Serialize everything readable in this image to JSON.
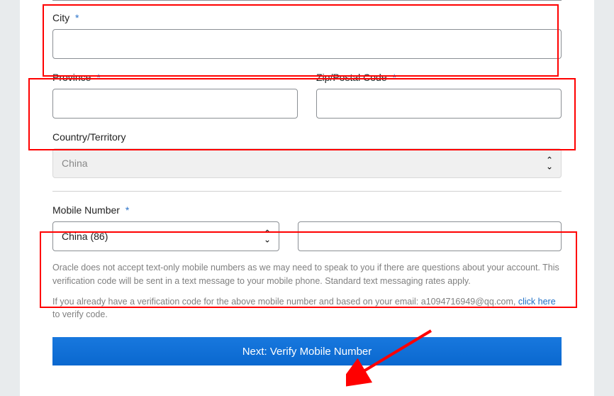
{
  "fields": {
    "city": {
      "label": "City",
      "value": ""
    },
    "province": {
      "label": "Province",
      "value": ""
    },
    "zip": {
      "label": "Zip/Postal Code",
      "value": ""
    },
    "country": {
      "label": "Country/Territory",
      "selected": "China"
    },
    "mobile": {
      "label": "Mobile Number",
      "country_code": "China (86)",
      "value": ""
    }
  },
  "help": {
    "line1": "Oracle does not accept text-only mobile numbers as we may need to speak to you if there are questions about your account. This verification code will be sent in a text message to your mobile phone. Standard text messaging rates apply.",
    "line2_a": "If you already have a verification code for the above mobile number and based on your email: ",
    "email": "a1094716949@qq.com",
    "line2_b": ", ",
    "link": "click here",
    "line2_c": " to verify code."
  },
  "button": {
    "next": "Next: Verify Mobile Number"
  },
  "required": "*"
}
